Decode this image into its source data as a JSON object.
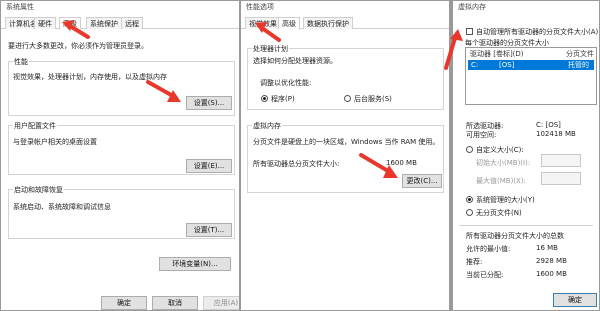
{
  "win1": {
    "title": "系统属性",
    "tabs": [
      "计算机名",
      "硬件",
      "高级",
      "系统保护",
      "远程"
    ],
    "admin_note": "要进行大多数更改，你必须作为管理员登录。",
    "perf": {
      "title": "性能",
      "desc": "视觉效果，处理器计划，内存使用，以及虚拟内存",
      "button": "设置(S)..."
    },
    "profiles": {
      "title": "用户配置文件",
      "desc": "与登录帐户相关的桌面设置",
      "button": "设置(E)..."
    },
    "startup": {
      "title": "启动和故障恢复",
      "desc": "系统启动、系统故障和调试信息",
      "button": "设置(T)..."
    },
    "env_button": "环境变量(N)...",
    "ok": "确定",
    "cancel": "取消",
    "apply": "应用(A)"
  },
  "win2": {
    "title": "性能选项",
    "tabs": [
      "视觉效果",
      "高级",
      "数据执行保护"
    ],
    "sched_title": "处理器计划",
    "sched_desc": "选择如何分配处理器资源。",
    "sched_label": "调整以优化性能:",
    "opt_programs": "程序(P)",
    "opt_services": "后台服务(S)",
    "vm_title": "虚拟内存",
    "vm_desc": "分页文件是硬盘上的一块区域，Windows 当作 RAM 使用。",
    "vm_total_label": "所有驱动器总分页文件大小:",
    "vm_total_value": "1600 MB",
    "change_button": "更改(C)..."
  },
  "win3": {
    "title": "虚拟内存",
    "auto_manage": "自动管理所有驱动器的分页文件大小(A)",
    "per_drive_title": "每个驱动器的分页文件大小",
    "col_drive": "驱动器 [卷标](D)",
    "col_size": "分页文件大小",
    "row_drive": "C:",
    "row_label": "[OS]",
    "row_size": "托管的",
    "selected_drive_label": "所选驱动器:",
    "selected_drive_value": "C:  [OS]",
    "space_label": "可用空间:",
    "space_value": "102418 MB",
    "custom_size": "自定义大小(C):",
    "initial_size": "初始大小(MB)(I):",
    "max_size": "最大值(MB)(X):",
    "system_managed": "系统管理的大小(Y)",
    "no_paging": "无分页文件(N)",
    "total_title": "所有驱动器分页文件大小的总数",
    "min_label": "允许的最小值:",
    "min_value": "16 MB",
    "rec_label": "推荐:",
    "rec_value": "2928 MB",
    "cur_label": "当前已分配:",
    "cur_value": "1600 MB",
    "ok": "确定"
  },
  "colors": {
    "arrow": "#e8382c",
    "selection": "#0078d7"
  }
}
